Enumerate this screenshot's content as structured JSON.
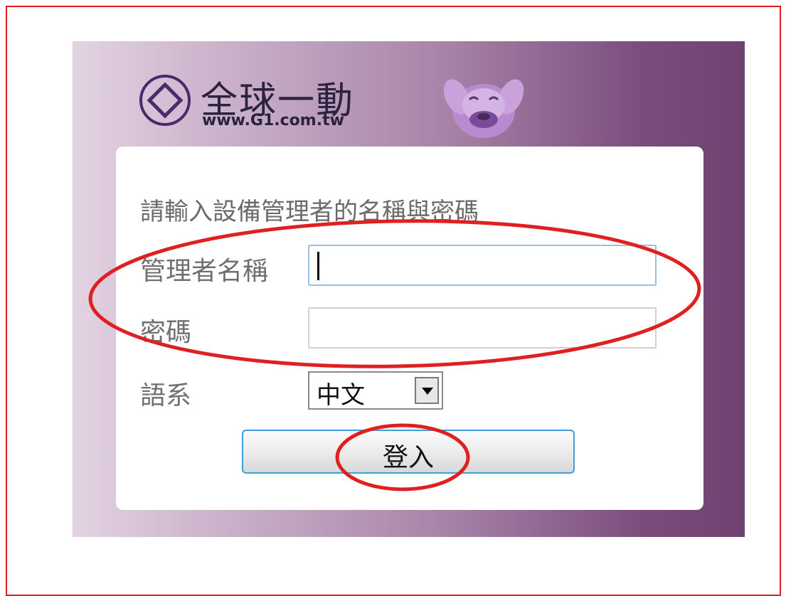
{
  "brand": {
    "title": "全球一動",
    "url": "www.G1.com.tw",
    "logo_icon": "g1-logo-icon"
  },
  "form": {
    "instruction": "請輸入設備管理者的名稱與密碼",
    "username_label": "管理者名稱",
    "username_value": "",
    "password_label": "密碼",
    "password_value": "",
    "language_label": "語系",
    "language_value": "中文",
    "login_label": "登入"
  },
  "colors": {
    "panel_dark": "#704272",
    "panel_light": "#e2d3e2",
    "annotation": "#e02020",
    "button_border": "#3ea0d6"
  }
}
